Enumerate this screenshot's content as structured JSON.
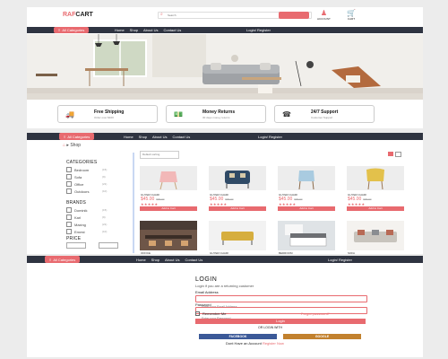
{
  "brand": {
    "prefix": "RAF",
    "suffix": "CART"
  },
  "search": {
    "placeholder": "Search"
  },
  "header_icons": {
    "account": "ACCOUNT",
    "cart": "CART"
  },
  "nav": {
    "categories_label": "All Categories",
    "links": [
      "Home",
      "Shop",
      "About Us",
      "Contact Us"
    ],
    "login_register": "Login/ Register"
  },
  "features": [
    {
      "icon": "truck-icon",
      "title": "Free Shipping",
      "subtitle": "Order over $100"
    },
    {
      "icon": "money-icon",
      "title": "Money Returns",
      "subtitle": "30 days money returns"
    },
    {
      "icon": "support-icon",
      "title": "24/7 Support",
      "subtitle": "Customer Support"
    }
  ],
  "shop": {
    "breadcrumb": "Shop",
    "categories_title": "CATEGORIES",
    "categories": [
      {
        "label": "Bedroom",
        "count": "(15)"
      },
      {
        "label": "Sofa",
        "count": "(9)"
      },
      {
        "label": "Office",
        "count": "(21)"
      },
      {
        "label": "Outdoors",
        "count": "(10)"
      }
    ],
    "brands_title": "BRANDS",
    "brands": [
      {
        "label": "Dominik",
        "count": "(15)"
      },
      {
        "label": "Karl",
        "count": "(9)"
      },
      {
        "label": "Maxing",
        "count": "(21)"
      },
      {
        "label": "Ernest",
        "count": "(10)"
      }
    ],
    "price_title": "PRICE",
    "sort": "Default sorting",
    "products": [
      {
        "name": "GUYER CHAIR",
        "price": "$45.00",
        "old": "$55.90",
        "rating": 5,
        "add": "Add to Cart"
      },
      {
        "name": "GUYER CHAIR",
        "price": "$45.00",
        "old": "$55.90",
        "rating": 5,
        "add": "Add to Cart"
      },
      {
        "name": "GUYER CHAIR",
        "price": "$45.00",
        "old": "$55.90",
        "rating": 5,
        "add": "Add to Cart"
      },
      {
        "name": "GUYER CHAIR",
        "price": "$45.00",
        "old": "$55.90",
        "rating": 5,
        "add": "Add to Cart"
      }
    ],
    "products2": [
      {
        "name": "OFFICE"
      },
      {
        "name": "GUYER CHAIR"
      },
      {
        "name": "BEDROOM"
      },
      {
        "name": "SOFA"
      }
    ]
  },
  "login": {
    "title": "LOGIN",
    "subtitle": "Login if you are a returning customer",
    "email_label": "Email Address",
    "email_placeholder": "Enter your Email Address",
    "password_label": "Password",
    "password_placeholder": "Enter your Password",
    "remember": "Remember Me",
    "forgot": "Forgot password?",
    "button": "Login",
    "or": "OR LOGIN WITH",
    "facebook": "FACEBOOK",
    "google": "GOOGLE",
    "no_account": "Dont Have an Account",
    "register": "Register Now"
  },
  "colors": {
    "accent": "#e86a6f",
    "nav": "#2f3441"
  }
}
